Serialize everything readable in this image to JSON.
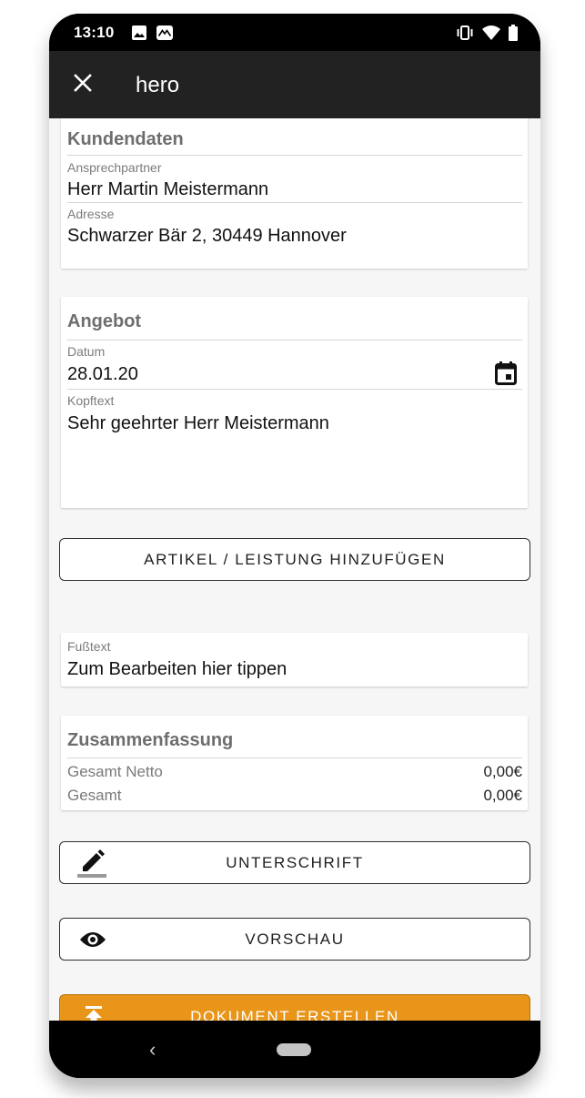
{
  "status_bar": {
    "time": "13:10",
    "icons": [
      "image-icon",
      "mountain-icon",
      "vibrate-icon",
      "wifi-icon",
      "battery-icon"
    ]
  },
  "app_bar": {
    "title": "hero",
    "close_icon": "close-icon"
  },
  "kundendaten": {
    "title": "Kundendaten",
    "contact_label": "Ansprechpartner",
    "contact_value": "Herr Martin Meistermann",
    "address_label": "Adresse",
    "address_value": "Schwarzer Bär 2, 30449 Hannover"
  },
  "angebot": {
    "title": "Angebot",
    "date_label": "Datum",
    "date_value": "28.01.20",
    "header_label": "Kopftext",
    "header_value": "Sehr geehrter Herr Meistermann"
  },
  "add_item_button": "ARTIKEL / LEISTUNG HINZUFÜGEN",
  "footer_text": {
    "label": "Fußtext",
    "value": "Zum Bearbeiten hier tippen"
  },
  "summary": {
    "title": "Zusammenfassung",
    "rows": [
      {
        "label": "Gesamt Netto",
        "value": "0,00€"
      },
      {
        "label": "Gesamt",
        "value": "0,00€"
      }
    ]
  },
  "signature_button": "UNTERSCHRIFT",
  "preview_button": "VORSCHAU",
  "create_button": "DOKUMENT ERSTELLEN",
  "colors": {
    "accent": "#e8951a",
    "app_bar": "#222222",
    "background": "#f6f6f6"
  }
}
